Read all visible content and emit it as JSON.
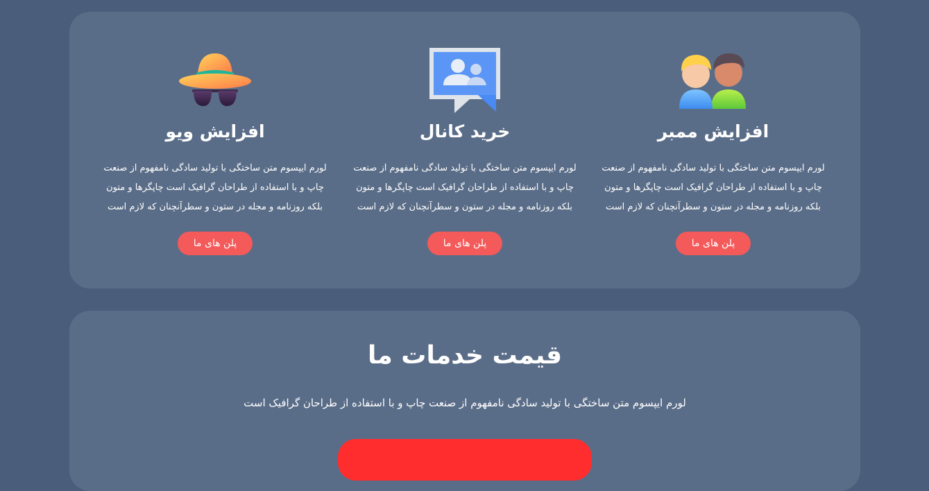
{
  "services": {
    "cards": [
      {
        "icon": "hat-sunglasses-icon",
        "title": "افزایش ویو",
        "description": "لورم ایپسوم متن ساختگی با تولید سادگی نامفهوم از صنعت چاپ و با استفاده از طراحان گرافیک است چاپگرها و متون بلکه روزنامه و مجله در ستون و سطرآنچنان که لازم است",
        "button": "پلن های ما"
      },
      {
        "icon": "group-chat-icon",
        "title": "خرید کانال",
        "description": "لورم ایپسوم متن ساختگی با تولید سادگی نامفهوم از صنعت چاپ و با استفاده از طراحان گرافیک است چاپگرها و متون بلکه روزنامه و مجله در ستون و سطرآنچنان که لازم است",
        "button": "پلن های ما"
      },
      {
        "icon": "two-users-icon",
        "title": "افزایش ممبر",
        "description": "لورم ایپسوم متن ساختگی با تولید سادگی نامفهوم از صنعت چاپ و با استفاده از طراحان گرافیک است چاپگرها و متون بلکه روزنامه و مجله در ستون و سطرآنچنان که لازم است",
        "button": "پلن های ما"
      }
    ]
  },
  "pricing": {
    "title": "قیمت خدمات ما",
    "description": "لورم ایپسوم متن ساختگی با تولید سادگی نامفهوم از صنعت چاپ و با استفاده از طراحان گرافیک است"
  },
  "colors": {
    "page_background": "#4a5d7a",
    "panel_background": "#5a6d88",
    "button": "#f45a5a",
    "cta": "#ff2d2d"
  }
}
